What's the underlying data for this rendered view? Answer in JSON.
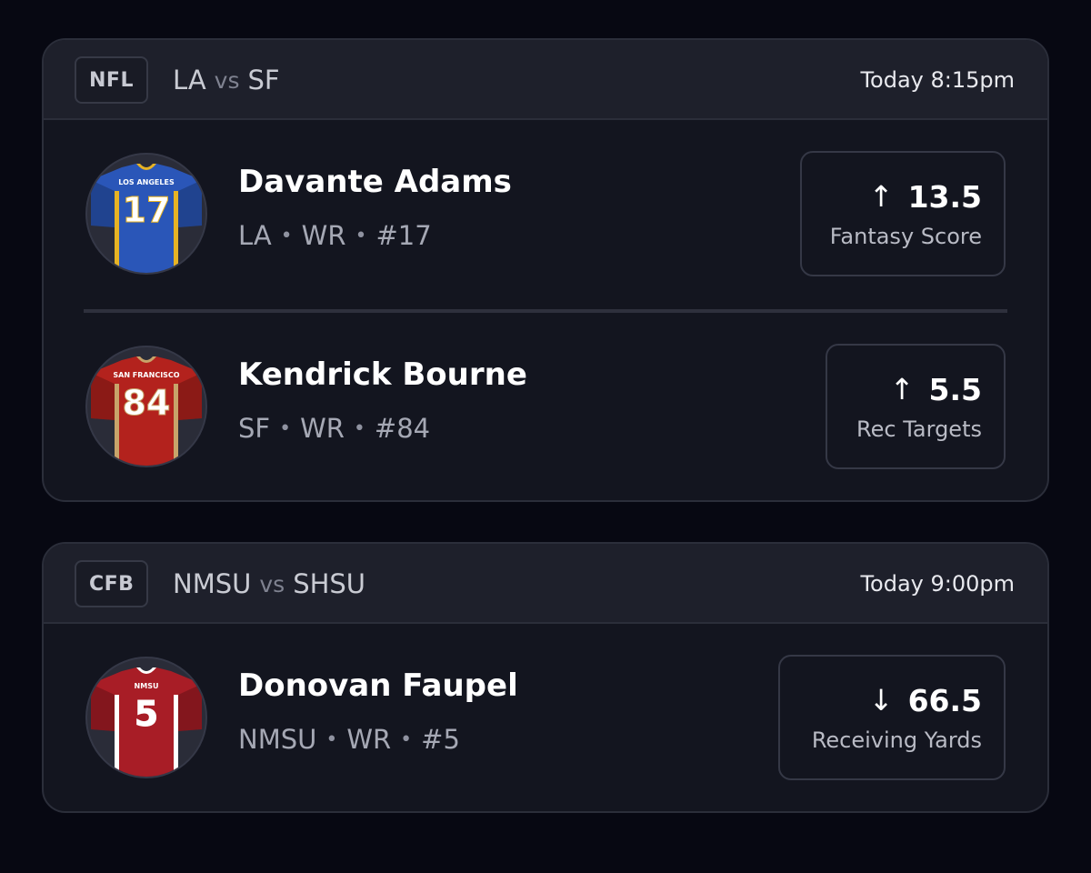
{
  "games": [
    {
      "league": "NFL",
      "home": "LA",
      "vs": "vs",
      "away": "SF",
      "time": "Today 8:15pm",
      "players": [
        {
          "name": "Davante Adams",
          "team": "LA",
          "position": "WR",
          "number": "#17",
          "jersey_text": "LOS ANGELES",
          "jersey_number": "17",
          "jersey_color": "#2a56b8",
          "jersey_trim": "#e7b324",
          "direction": "up",
          "arrow": "↑",
          "line": "13.5",
          "stat": "Fantasy Score"
        },
        {
          "name": "Kendrick Bourne",
          "team": "SF",
          "position": "WR",
          "number": "#84",
          "jersey_text": "SAN FRANCISCO",
          "jersey_number": "84",
          "jersey_color": "#b3221d",
          "jersey_trim": "#c8a46a",
          "direction": "up",
          "arrow": "↑",
          "line": "5.5",
          "stat": "Rec Targets"
        }
      ]
    },
    {
      "league": "CFB",
      "home": "NMSU",
      "vs": "vs",
      "away": "SHSU",
      "time": "Today 9:00pm",
      "players": [
        {
          "name": "Donovan Faupel",
          "team": "NMSU",
          "position": "WR",
          "number": "#5",
          "jersey_text": "NMSU",
          "jersey_number": "5",
          "jersey_color": "#a81d26",
          "jersey_trim": "#ffffff",
          "direction": "down",
          "arrow": "↓",
          "line": "66.5",
          "stat": "Receiving Yards"
        }
      ]
    }
  ],
  "separator": "•"
}
